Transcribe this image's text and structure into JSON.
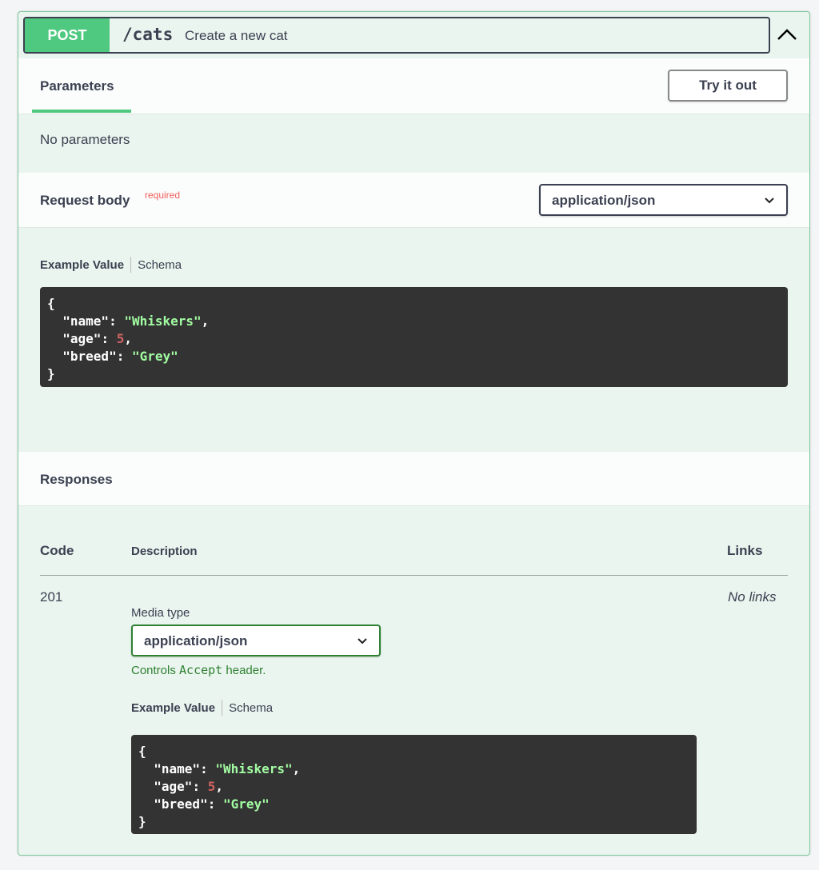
{
  "operation": {
    "method": "POST",
    "path": "/cats",
    "summary": "Create a new cat"
  },
  "parameters": {
    "tab_label": "Parameters",
    "try_button": "Try it out",
    "empty_text": "No parameters"
  },
  "request_body": {
    "title": "Request body",
    "required_label": "required",
    "content_type": "application/json",
    "example_tab": "Example Value",
    "schema_tab": "Schema"
  },
  "responses": {
    "title": "Responses",
    "col_code": "Code",
    "col_description": "Description",
    "col_links": "Links",
    "rows": [
      {
        "code": "201",
        "links": "No links",
        "media_type_label": "Media type",
        "media_type": "application/json",
        "controls_prefix": "Controls",
        "controls_mono": "Accept",
        "controls_suffix": "header.",
        "example_tab": "Example Value",
        "schema_tab": "Schema"
      }
    ]
  },
  "example": {
    "open": "{",
    "close": "}",
    "name_key": "\"name\"",
    "name_val": "\"Whiskers\"",
    "age_key": "\"age\"",
    "age_val": "5",
    "breed_key": "\"breed\"",
    "breed_val": "\"Grey\""
  },
  "icons": {
    "collapse": "chevron-up-icon",
    "select": "chevron-down-icon"
  },
  "colors": {
    "post_green": "#4fc97f",
    "required_red": "#f25f5c",
    "note_green": "#2f8132"
  }
}
